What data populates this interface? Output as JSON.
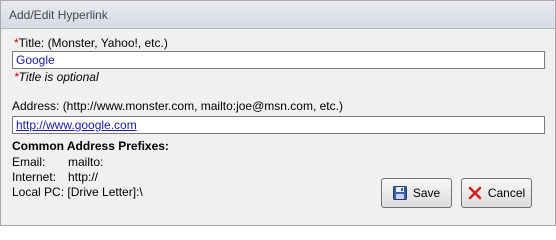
{
  "window": {
    "title": "Add/Edit Hyperlink"
  },
  "title_field": {
    "required_mark": "*",
    "label": "Title: (Monster, Yahoo!, etc.)",
    "value": "Google",
    "note": "Title is optional"
  },
  "address_field": {
    "label": "Address: (http://www.monster.com, mailto:joe@msn.com, etc.)",
    "value": "http://www.google.com"
  },
  "prefixes": {
    "heading": "Common Address Prefixes:",
    "items": [
      {
        "key": "Email:",
        "value": "mailto:"
      },
      {
        "key": "Internet:",
        "value": "http://"
      },
      {
        "key": "Local PC:",
        "value": "[Drive Letter]:\\"
      }
    ]
  },
  "buttons": {
    "save": {
      "label": "Save",
      "icon": "floppy-disk-icon"
    },
    "cancel": {
      "label": "Cancel",
      "icon": "red-x-icon"
    }
  },
  "colors": {
    "required": "#d00000",
    "link_text": "#1a1a9c"
  }
}
